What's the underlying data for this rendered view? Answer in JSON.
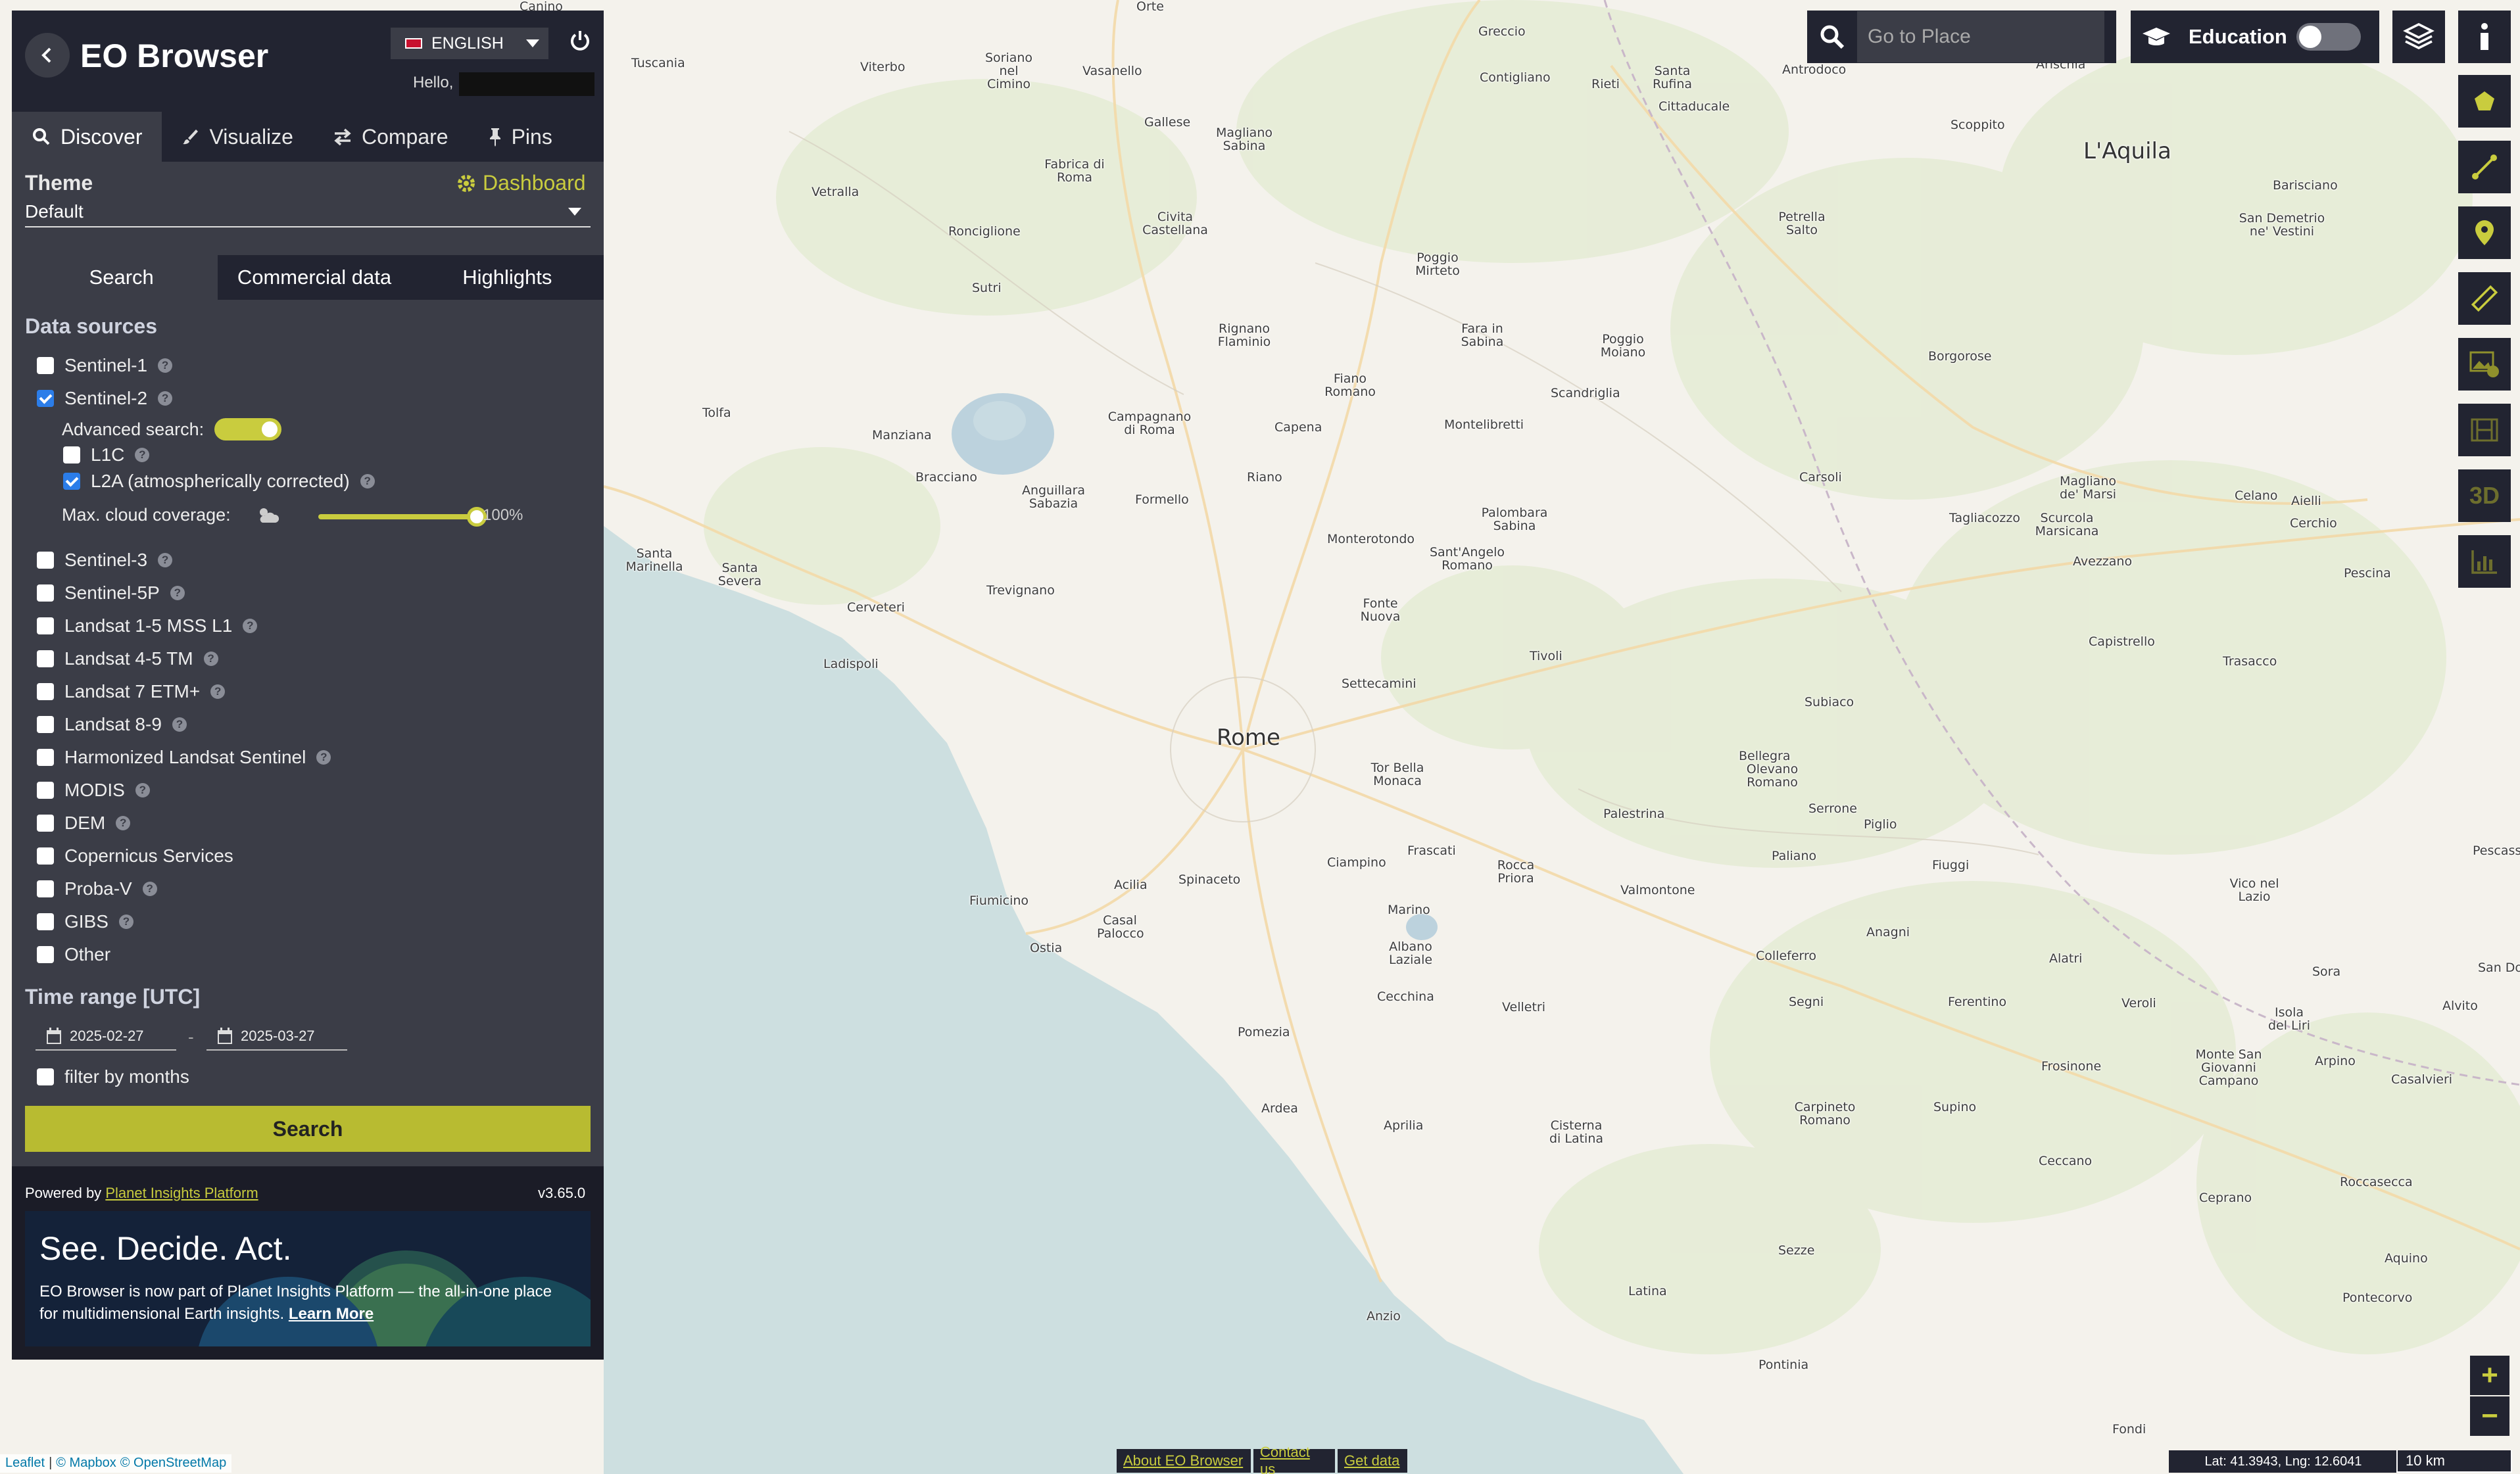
{
  "app": {
    "title": "EO Browser",
    "language": "ENGLISH",
    "hello": "Hello,"
  },
  "nav_tabs": [
    "Discover",
    "Visualize",
    "Compare",
    "Pins"
  ],
  "theme": {
    "label": "Theme",
    "dashboard": "Dashboard",
    "selected": "Default"
  },
  "sub_tabs": [
    "Search",
    "Commercial data",
    "Highlights"
  ],
  "data_sources": {
    "title": "Data sources",
    "items": [
      {
        "label": "Sentinel-1",
        "checked": false
      },
      {
        "label": "Sentinel-2",
        "checked": true
      },
      {
        "label": "Sentinel-3",
        "checked": false
      },
      {
        "label": "Sentinel-5P",
        "checked": false
      },
      {
        "label": "Landsat 1-5 MSS L1",
        "checked": false
      },
      {
        "label": "Landsat 4-5 TM",
        "checked": false
      },
      {
        "label": "Landsat 7 ETM+",
        "checked": false
      },
      {
        "label": "Landsat 8-9",
        "checked": false
      },
      {
        "label": "Harmonized Landsat Sentinel",
        "checked": false
      },
      {
        "label": "MODIS",
        "checked": false
      },
      {
        "label": "DEM",
        "checked": false
      },
      {
        "label": "Copernicus Services",
        "checked": false
      },
      {
        "label": "Proba-V",
        "checked": false
      },
      {
        "label": "GIBS",
        "checked": false
      },
      {
        "label": "Other",
        "checked": false
      }
    ],
    "advanced_search": "Advanced search:",
    "l1c": "L1C",
    "l2a": "L2A (atmospherically corrected)",
    "max_cloud": "Max. cloud coverage:",
    "cloud_value": "100%",
    "cloud_fraction": 1.0
  },
  "time_range": {
    "title": "Time range [UTC]",
    "from": "2025-02-27",
    "to": "2025-03-27",
    "dash": "-",
    "filter_months": "filter by months"
  },
  "search_button": "Search",
  "footer": {
    "powered_by": "Powered by",
    "platform": "Planet Insights Platform",
    "version": "v3.65.0"
  },
  "promo": {
    "heading": "See. Decide. Act.",
    "text": "EO Browser is now part of Planet Insights Platform — the all-in-one place for multidimensional Earth insights.",
    "link": "Learn More"
  },
  "top_right": {
    "goto_placeholder": "Go to Place",
    "education": "Education"
  },
  "right_tools": {
    "three_d": "3D"
  },
  "zoom": {
    "in": "+",
    "out": "−"
  },
  "attribution": {
    "leaflet": "Leaflet",
    "mapbox": "© Mapbox",
    "osm": "© OpenStreetMap"
  },
  "bottom_links": [
    "About EO Browser",
    "Contact us",
    "Get data"
  ],
  "coords": "Lat: 41.3943, Lng: 12.6041",
  "scale": "10 km",
  "places": [
    {
      "name": "Rome",
      "big": true
    },
    {
      "name": "L'Aquila",
      "big": true
    },
    {
      "name": "Viterbo"
    },
    {
      "name": "Soriano nel Cimino"
    },
    {
      "name": "Vasanello"
    },
    {
      "name": "Tuscania"
    },
    {
      "name": "Vetralla"
    },
    {
      "name": "Fabrica di Roma"
    },
    {
      "name": "Gallese"
    },
    {
      "name": "Magliano Sabina"
    },
    {
      "name": "Civita Castellana"
    },
    {
      "name": "Ronciglione"
    },
    {
      "name": "Sutri"
    },
    {
      "name": "Greccio"
    },
    {
      "name": "Contigliano"
    },
    {
      "name": "Rieti"
    },
    {
      "name": "Santa Rufina"
    },
    {
      "name": "Cittaducale"
    },
    {
      "name": "Antrodoco"
    },
    {
      "name": "Scoppito"
    },
    {
      "name": "Barisciano"
    },
    {
      "name": "San Demetrio ne' Vestini"
    },
    {
      "name": "Petrella Salto"
    },
    {
      "name": "Poggio Mirteto"
    },
    {
      "name": "Rignano Flaminio"
    },
    {
      "name": "Fara in Sabina"
    },
    {
      "name": "Poggio Moiano"
    },
    {
      "name": "Borgorose"
    },
    {
      "name": "Fiano Romano"
    },
    {
      "name": "Scandriglia"
    },
    {
      "name": "Tolfa"
    },
    {
      "name": "Manziana"
    },
    {
      "name": "Campagnano di Roma"
    },
    {
      "name": "Capena"
    },
    {
      "name": "Montelibretti"
    },
    {
      "name": "Bracciano"
    },
    {
      "name": "Anguillara Sabazia"
    },
    {
      "name": "Riano"
    },
    {
      "name": "Formello"
    },
    {
      "name": "Carsoli"
    },
    {
      "name": "Magliano de' Marsi"
    },
    {
      "name": "Tagliacozzo"
    },
    {
      "name": "Scurcola Marsicana"
    },
    {
      "name": "Celano"
    },
    {
      "name": "Aielli"
    },
    {
      "name": "Cerchio"
    },
    {
      "name": "Monterotondo"
    },
    {
      "name": "Palombara Sabina"
    },
    {
      "name": "Sant'Angelo Romano"
    },
    {
      "name": "Avezzano"
    },
    {
      "name": "Pescina"
    },
    {
      "name": "Santa Marinella"
    },
    {
      "name": "Santa Severa"
    },
    {
      "name": "Cerveteri"
    },
    {
      "name": "Trevignano"
    },
    {
      "name": "Fonte Nuova"
    },
    {
      "name": "Capistrello"
    },
    {
      "name": "Ladispoli"
    },
    {
      "name": "Tivoli"
    },
    {
      "name": "Trasacco"
    },
    {
      "name": "Settecamini"
    },
    {
      "name": "Subiaco"
    },
    {
      "name": "Bellegra"
    },
    {
      "name": "Olevano Romano"
    },
    {
      "name": "Serrone"
    },
    {
      "name": "Piglio"
    },
    {
      "name": "Tor Bella Monaca"
    },
    {
      "name": "Palestrina"
    },
    {
      "name": "Fiuggi"
    },
    {
      "name": "Frascati"
    },
    {
      "name": "Paliano"
    },
    {
      "name": "Fiumicino"
    },
    {
      "name": "Acilia"
    },
    {
      "name": "Spinaceto"
    },
    {
      "name": "Ciampino"
    },
    {
      "name": "Rocca Priora"
    },
    {
      "name": "Valmontone"
    },
    {
      "name": "Vico nel Lazio"
    },
    {
      "name": "Marino"
    },
    {
      "name": "Casal Palocco"
    },
    {
      "name": "Ostia"
    },
    {
      "name": "Anagni"
    },
    {
      "name": "Albano Laziale"
    },
    {
      "name": "Colleferro"
    },
    {
      "name": "Alatri"
    },
    {
      "name": "Sora"
    },
    {
      "name": "San Donato"
    },
    {
      "name": "Cecchina"
    },
    {
      "name": "Velletri"
    },
    {
      "name": "Segni"
    },
    {
      "name": "Ferentino"
    },
    {
      "name": "Veroli"
    },
    {
      "name": "Isola del Liri"
    },
    {
      "name": "Alvito"
    },
    {
      "name": "Pomezia"
    },
    {
      "name": "Frosinone"
    },
    {
      "name": "Monte San Giovanni Campano"
    },
    {
      "name": "Arpino"
    },
    {
      "name": "Casalvieri"
    },
    {
      "name": "Ardea"
    },
    {
      "name": "Aprilia"
    },
    {
      "name": "Cisterna di Latina"
    },
    {
      "name": "Carpineto Romano"
    },
    {
      "name": "Supino"
    },
    {
      "name": "Ceccano"
    },
    {
      "name": "Roccasecca"
    },
    {
      "name": "Ceprano"
    },
    {
      "name": "Sezze"
    },
    {
      "name": "Aquino"
    },
    {
      "name": "Latina"
    },
    {
      "name": "Pontecorvo"
    },
    {
      "name": "Anzio"
    },
    {
      "name": "Pontinia"
    },
    {
      "name": "Fondi"
    },
    {
      "name": "Orte"
    },
    {
      "name": "Canino"
    },
    {
      "name": "Arischia"
    },
    {
      "name": "Pescasseroli"
    }
  ],
  "colors": {
    "accent": "#c9cc3e",
    "panel": "#3b3d47",
    "panel_dark": "#222431",
    "sea": "#cddfe0",
    "land": "#f4f2ec"
  }
}
